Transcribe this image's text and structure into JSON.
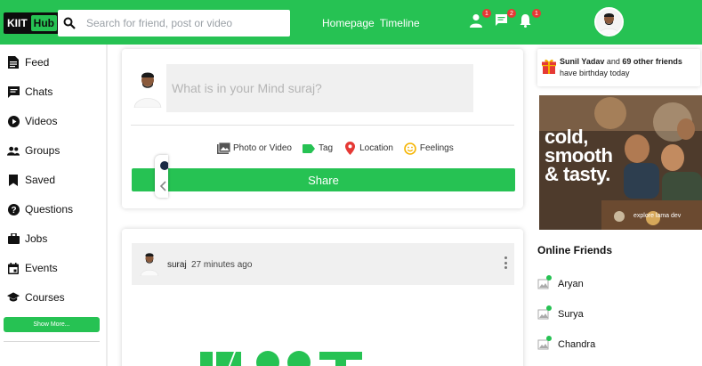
{
  "header": {
    "logo_left": "KIIT",
    "logo_right": "Hub",
    "search_placeholder": "Search for friend, post or video",
    "links": [
      "Homepage",
      "Timeline"
    ],
    "badges": [
      "1",
      "2",
      "1"
    ]
  },
  "sidebar": {
    "items": [
      {
        "label": "Feed",
        "icon": "feed-icon"
      },
      {
        "label": "Chats",
        "icon": "chat-icon"
      },
      {
        "label": "Videos",
        "icon": "play-circle-icon"
      },
      {
        "label": "Groups",
        "icon": "groups-icon"
      },
      {
        "label": "Saved",
        "icon": "bookmark-icon"
      },
      {
        "label": "Questions",
        "icon": "help-circle-icon"
      },
      {
        "label": "Jobs",
        "icon": "briefcase-icon"
      },
      {
        "label": "Events",
        "icon": "calendar-icon"
      },
      {
        "label": "Courses",
        "icon": "school-icon"
      }
    ],
    "show_more": "Show More..."
  },
  "composer": {
    "placeholder": "What is in your Mind suraj?",
    "options": [
      {
        "label": "Photo or Video",
        "icon": "photo-icon",
        "color": "#555555"
      },
      {
        "label": "Tag",
        "icon": "tag-icon",
        "color": "#26c253"
      },
      {
        "label": "Location",
        "icon": "location-pin-icon",
        "color": "#e53935"
      },
      {
        "label": "Feelings",
        "icon": "smile-icon",
        "color": "#f5b400"
      }
    ],
    "share": "Share"
  },
  "post": {
    "user": "suraj",
    "time": "27 minutes ago"
  },
  "rightbar": {
    "birthday": {
      "name": "Sunil Yadav",
      "middle": " and ",
      "count": "69 other friends",
      "suffix": " have birthday today"
    },
    "ad": {
      "line1": "cold,",
      "line2": "smooth",
      "line3": "& tasty.",
      "small": "explore lama dev"
    },
    "online_title": "Online Friends",
    "friends": [
      "Aryan",
      "Surya",
      "Chandra"
    ]
  },
  "colors": {
    "accent": "#26c253",
    "badge": "#e53935"
  }
}
